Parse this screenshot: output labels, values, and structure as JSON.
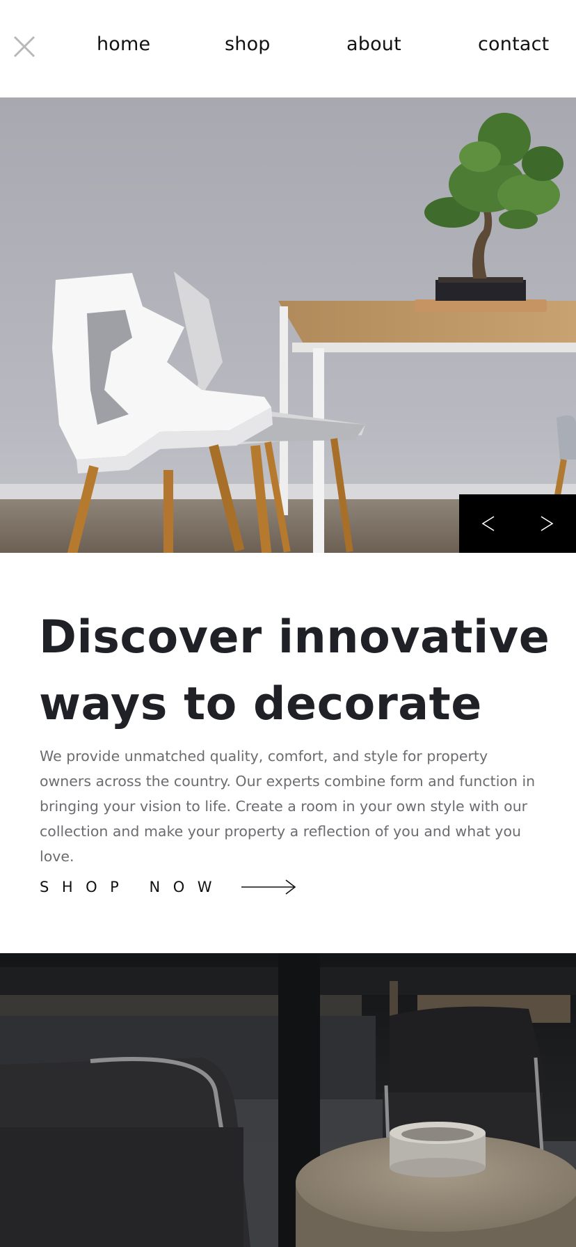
{
  "nav": {
    "close_icon": "close-icon",
    "links": {
      "home": "home",
      "shop": "shop",
      "about": "about",
      "contact": "contact"
    }
  },
  "hero": {
    "image": "photo of white chairs at a wooden table with a bonsai tree",
    "prev_icon": "chevron-left-icon",
    "next_icon": "chevron-right-icon"
  },
  "content": {
    "headline": "Discover innovative ways to decorate",
    "description": "We provide unmatched quality, comfort, and style for property owners across the country. Our experts combine form and function in bringing your vision to life. Create a room in your own style with our collection and make your property a reflection of you and what you love.",
    "cta_label": "SHOP NOW",
    "cta_icon": "arrow-right-icon"
  },
  "second_image": {
    "image": "dark photo of black armchairs and a round wooden coffee table"
  },
  "colors": {
    "text_dark": "#1f2127",
    "text_muted": "#6b6c70",
    "close_icon": "#b8b8b8",
    "slider_bg": "#000000"
  }
}
